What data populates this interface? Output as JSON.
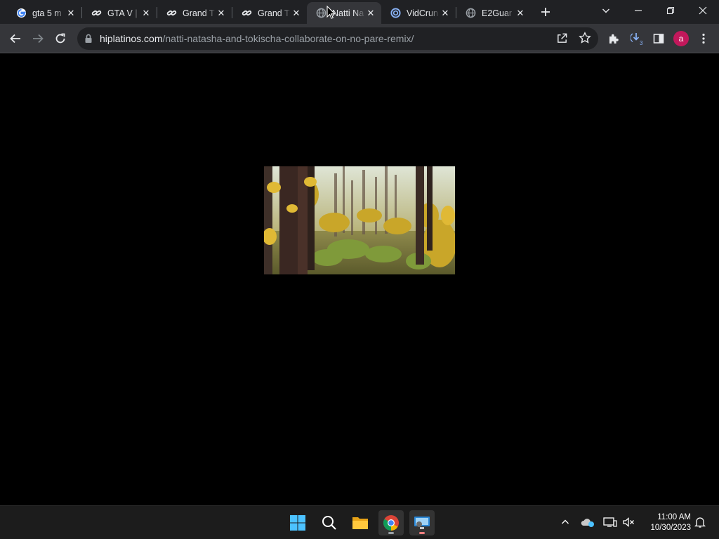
{
  "browser": {
    "tabs": [
      {
        "title": "gta 5 m",
        "favicon": "google-icon"
      },
      {
        "title": "GTA V |",
        "favicon": "link-icon"
      },
      {
        "title": "Grand T",
        "favicon": "link-icon"
      },
      {
        "title": "Grand T",
        "favicon": "link-icon"
      },
      {
        "title": "Natti Na",
        "favicon": "globe-icon",
        "active": true
      },
      {
        "title": "VidCrun",
        "favicon": "vidcrunch-icon"
      },
      {
        "title": "E2Guar",
        "favicon": "globe-icon"
      }
    ],
    "address": {
      "host": "hiplatinos.com",
      "path": "/natti-natasha-and-tokischa-collaborate-on-no-pare-remix/"
    },
    "profile_initial": "a",
    "extension_badge": "3"
  },
  "taskbar": {
    "time": "11:00 AM",
    "date": "10/30/2023",
    "apps": [
      "start-icon",
      "search-icon",
      "file-explorer-icon",
      "chrome-icon",
      "remote-desktop-icon"
    ]
  },
  "colors": {
    "tabstrip": "#202124",
    "toolbar": "#35363a",
    "page_background": "#000000",
    "avatar": "#c2185b"
  }
}
